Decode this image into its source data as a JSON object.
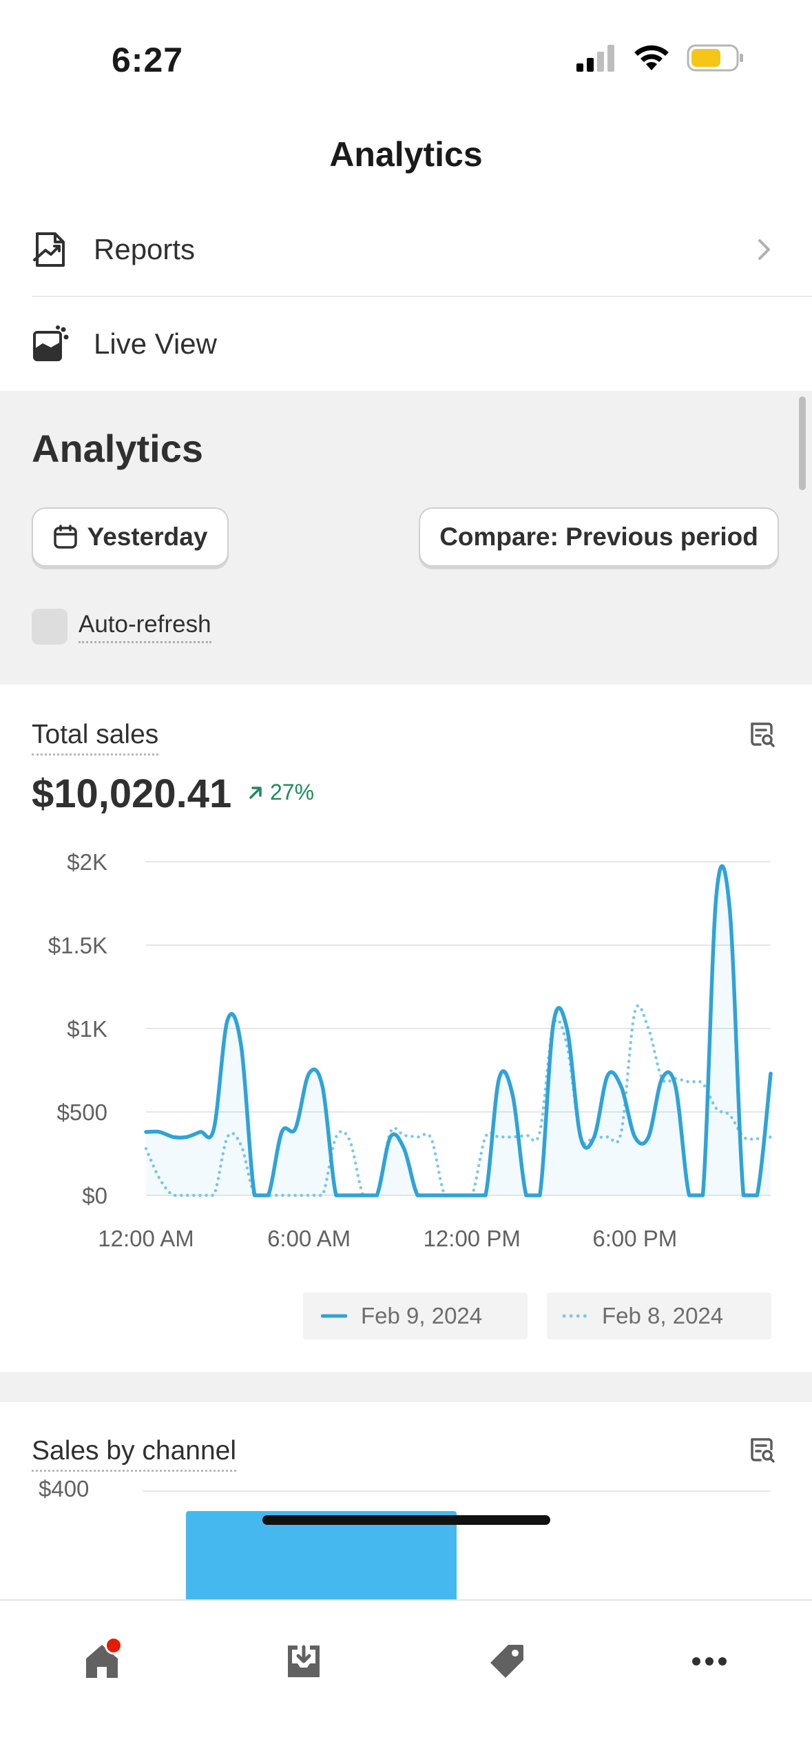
{
  "status_bar": {
    "time": "6:27"
  },
  "nav": {
    "title": "Analytics"
  },
  "menu": {
    "items": [
      {
        "label": "Reports",
        "icon": "report-chart-icon"
      },
      {
        "label": "Live View",
        "icon": "live-view-icon"
      }
    ]
  },
  "analytics": {
    "heading": "Analytics",
    "date_button": "Yesterday",
    "compare_button": "Compare: Previous period",
    "auto_refresh_label": "Auto-refresh",
    "auto_refresh_checked": false
  },
  "total_sales": {
    "title": "Total sales",
    "value": "$10,020.41",
    "change": "27%",
    "change_direction": "up",
    "change_color": "#1f8a5a"
  },
  "chart_data": {
    "type": "line",
    "y_ticks": [
      "$2K",
      "$1.5K",
      "$1K",
      "$500",
      "$0"
    ],
    "y_tick_values": [
      2000,
      1500,
      1000,
      500,
      0
    ],
    "ylim": [
      0,
      2000
    ],
    "x_ticks": [
      "12:00 AM",
      "6:00 AM",
      "12:00 PM",
      "6:00 PM"
    ],
    "x_tick_hours": [
      0,
      6,
      12,
      18
    ],
    "xlim": [
      0,
      23
    ],
    "grid": true,
    "legend_position": "bottom-right",
    "series": [
      {
        "name": "Feb 9, 2024",
        "style": "solid",
        "color": "#2ea3d8",
        "x": [
          0,
          0.5,
          1,
          1.5,
          2,
          2.5,
          3,
          3.5,
          4,
          4.5,
          5,
          5.5,
          6,
          6.5,
          7,
          7.5,
          8,
          8.5,
          9,
          9.5,
          10,
          10.5,
          11,
          11.5,
          12,
          12.5,
          13,
          13.5,
          14,
          14.5,
          15,
          15.5,
          16,
          16.5,
          17,
          17.5,
          18,
          18.5,
          19,
          19.5,
          20,
          20.5,
          21,
          21.5,
          22,
          22.5,
          23
        ],
        "y": [
          380,
          380,
          350,
          350,
          380,
          400,
          1050,
          900,
          0,
          0,
          380,
          400,
          730,
          650,
          0,
          0,
          0,
          0,
          350,
          280,
          0,
          0,
          0,
          0,
          0,
          0,
          700,
          600,
          0,
          0,
          1030,
          1000,
          350,
          350,
          720,
          650,
          350,
          350,
          700,
          650,
          0,
          0,
          1800,
          1700,
          0,
          0,
          730
        ]
      },
      {
        "name": "Feb 8, 2024",
        "style": "dotted",
        "color": "#7cc8ea",
        "x": [
          0,
          0.5,
          1,
          1.5,
          2,
          2.5,
          3,
          3.5,
          4,
          4.5,
          5,
          5.5,
          6,
          6.5,
          7,
          7.5,
          8,
          8.5,
          9,
          9.5,
          10,
          10.5,
          11,
          11.5,
          12,
          12.5,
          13,
          13.5,
          14,
          14.5,
          15,
          15.5,
          16,
          16.5,
          17,
          17.5,
          18,
          18.5,
          19,
          19.5,
          20,
          20.5,
          21,
          21.5,
          22,
          22.5,
          23
        ],
        "y": [
          280,
          100,
          0,
          0,
          0,
          0,
          350,
          300,
          0,
          0,
          0,
          0,
          0,
          0,
          350,
          330,
          0,
          0,
          380,
          360,
          350,
          340,
          0,
          0,
          0,
          350,
          350,
          350,
          360,
          380,
          1020,
          900,
          350,
          350,
          350,
          380,
          1100,
          1000,
          700,
          700,
          680,
          670,
          520,
          480,
          350,
          340,
          350
        ]
      }
    ]
  },
  "legend": {
    "current": "Feb 9, 2024",
    "previous": "Feb 8, 2024"
  },
  "sales_by_channel": {
    "title": "Sales by channel",
    "y_tick": "$400",
    "bar_color": "#45b9ef"
  },
  "tab_bar": {
    "items": [
      {
        "name": "home",
        "icon": "home-icon",
        "has_notification": true
      },
      {
        "name": "orders",
        "icon": "inbox-download-icon"
      },
      {
        "name": "products",
        "icon": "tag-icon"
      },
      {
        "name": "more",
        "icon": "more-horizontal-icon"
      }
    ]
  }
}
